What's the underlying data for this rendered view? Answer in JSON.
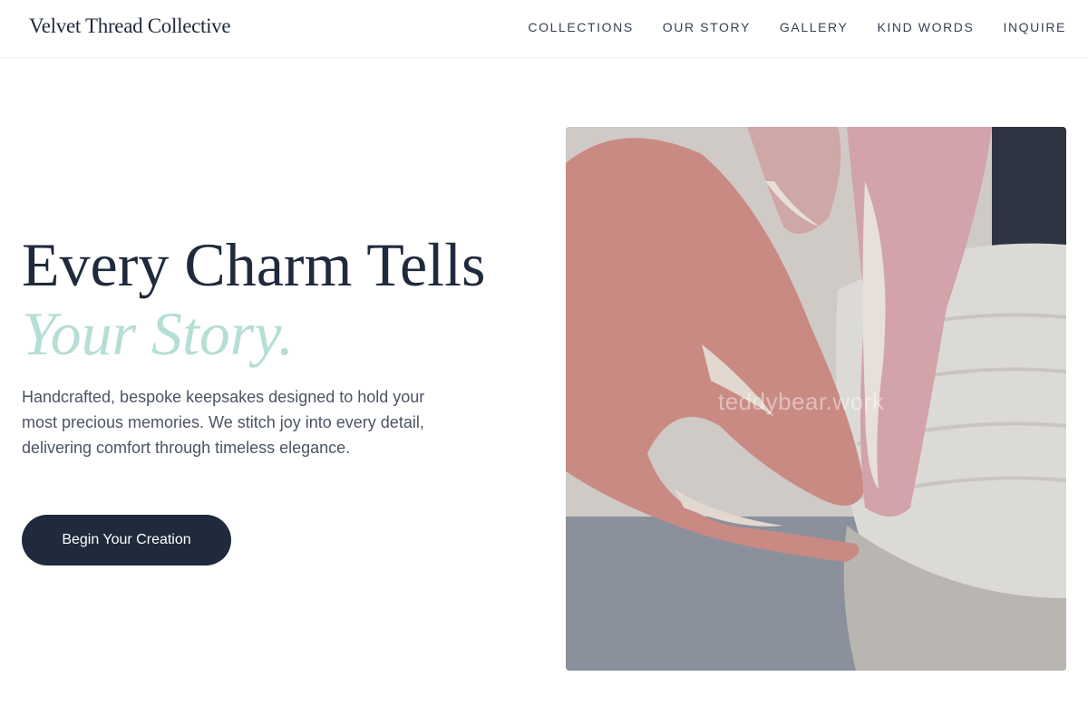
{
  "header": {
    "brand": "Velvet Thread Collective",
    "nav": [
      "COLLECTIONS",
      "OUR STORY",
      "GALLERY",
      "KIND WORDS",
      "INQUIRE"
    ]
  },
  "hero": {
    "title_line1": "Every Charm Tells",
    "title_line2": "Your Story.",
    "description": "Handcrafted, bespoke keepsakes designed to hold your most precious memories. We stitch joy into every detail, delivering comfort through timeless elegance.",
    "cta_label": "Begin Your Creation",
    "image_watermark": "teddybear.work"
  },
  "colors": {
    "primary": "#1f2a3c",
    "accent": "#b5ded6",
    "body_text": "#4b5563"
  }
}
